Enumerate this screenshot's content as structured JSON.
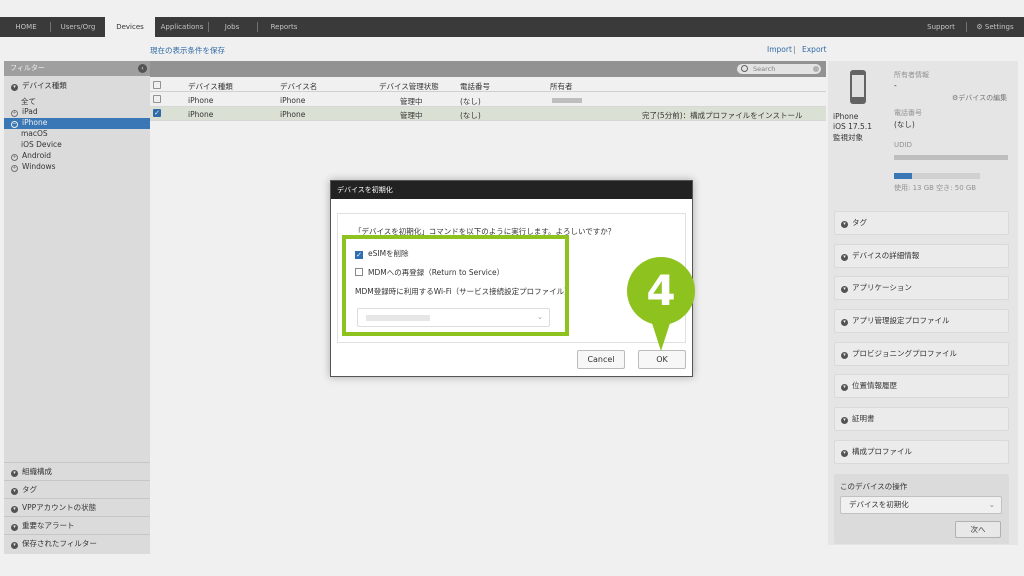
{
  "topnav": {
    "tabs": [
      "HOME",
      "Users/Org",
      "Devices",
      "Applications",
      "Jobs",
      "Reports"
    ],
    "active_tab": "Devices",
    "support": "Support",
    "settings": "Settings"
  },
  "subhead": {
    "save_filter": "現在の表示条件を保存",
    "import": "Import",
    "divider": "|",
    "export": "Export"
  },
  "sidebar": {
    "filter_title": "フィルター",
    "device_type_label": "デバイス種類",
    "items": [
      "全て",
      "iPad",
      "iPhone",
      "macOS",
      "iOS Device",
      "Android",
      "Windows"
    ],
    "selected": "iPhone",
    "sections": [
      "組織構成",
      "タグ",
      "VPPアカウントの状態",
      "重要なアラート",
      "保存されたフィルター"
    ]
  },
  "table": {
    "search_placeholder": "Search",
    "headers": [
      "デバイス種類",
      "デバイス名",
      "デバイス管理状態",
      "電話番号",
      "所有者"
    ],
    "rows": [
      {
        "type": "iPhone",
        "name": "iPhone",
        "status": "管理中",
        "phone": "(なし)",
        "owner": "",
        "note": "",
        "checked": false
      },
      {
        "type": "iPhone",
        "name": "iPhone",
        "status": "管理中",
        "phone": "(なし)",
        "owner": "",
        "note": "完了(5分前)：構成プロファイルをインストール",
        "checked": true
      }
    ]
  },
  "right_panel": {
    "owner_info_label": "所有者情報",
    "owner_value": "-",
    "edit_device": "デバイスの編集",
    "device_model": "iPhone",
    "ios_version": "iOS 17.5.1",
    "supervised": "監視対象",
    "phone_label": "電話番号",
    "phone_value": "(なし)",
    "udid_label": "UDID",
    "storage_text": "使用: 13 GB  空き: 50 GB",
    "storage_used_fraction": 0.21,
    "accordions": [
      "タグ",
      "デバイスの詳細情報",
      "アプリケーション",
      "アプリ管理設定プロファイル",
      "プロビジョニングプロファイル",
      "位置情報履歴",
      "証明書",
      "構成プロファイル"
    ],
    "ops_title": "このデバイスの操作",
    "ops_selected": "デバイスを初期化",
    "next_button": "次へ"
  },
  "modal": {
    "title": "デバイスを初期化",
    "question": "「デバイスを初期化」コマンドを以下のように実行します。よろしいですか？",
    "esim_label": "eSIMを削除",
    "esim_checked": true,
    "reenroll_label": "MDMへの再登録（Return to Service）",
    "reenroll_checked": false,
    "wifi_label": "MDM登録時に利用するWi-Fi（サービス接続設定プロファイル）",
    "cancel": "Cancel",
    "ok": "OK"
  },
  "badge": {
    "number": "4"
  },
  "colors": {
    "accent": "#8dc21f",
    "selection": "#3a7cc0",
    "nav_bg": "#3a3a3a"
  }
}
